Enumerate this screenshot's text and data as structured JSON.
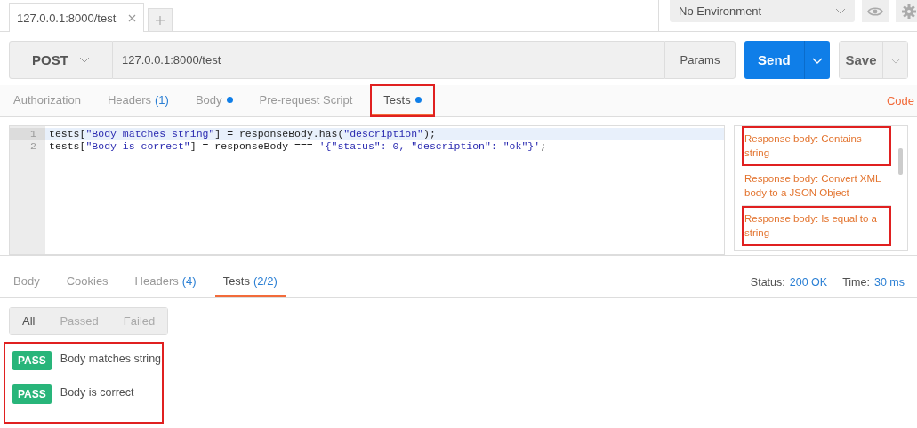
{
  "request_tabs": [
    {
      "label": "127.0.0.1:8000/test",
      "selected": true
    }
  ],
  "environment": {
    "value": "No Environment"
  },
  "request": {
    "method": "POST",
    "url": "127.0.0.1:8000/test",
    "params_button": "Params",
    "send_button": "Send",
    "save_button": "Save"
  },
  "request_sections": [
    {
      "label": "Authorization",
      "selected": false,
      "modified": false,
      "highlighted": false
    },
    {
      "label": "Headers",
      "count": "(1)",
      "selected": false,
      "modified": false,
      "highlighted": false
    },
    {
      "label": "Body",
      "selected": false,
      "modified": true,
      "highlighted": false
    },
    {
      "label": "Pre-request Script",
      "selected": false,
      "modified": false,
      "highlighted": false
    },
    {
      "label": "Tests",
      "selected": true,
      "modified": true,
      "highlighted": true
    }
  ],
  "code_link": "Code",
  "editor": {
    "lines": [
      {
        "number": "1",
        "active": true,
        "tokens": [
          {
            "kind": "plain",
            "text": "tests["
          },
          {
            "kind": "string",
            "text": "\"Body matches string\""
          },
          {
            "kind": "plain",
            "text": "] = responseBody.has("
          },
          {
            "kind": "string",
            "text": "\"description\""
          },
          {
            "kind": "plain",
            "text": ");"
          }
        ]
      },
      {
        "number": "2",
        "active": false,
        "tokens": [
          {
            "kind": "plain",
            "text": "tests["
          },
          {
            "kind": "string",
            "text": "\"Body is correct\""
          },
          {
            "kind": "plain",
            "text": "] = responseBody === "
          },
          {
            "kind": "string",
            "text": "'{\"status\": 0, \"description\": \"ok\"}'"
          },
          {
            "kind": "plain",
            "text": ";"
          }
        ]
      }
    ]
  },
  "snippets": [
    {
      "label": "Response body: Contains string",
      "highlighted": true
    },
    {
      "label": "Response body: Convert XML body to a JSON Object",
      "highlighted": false
    },
    {
      "label": "Response body: Is equal to a string",
      "highlighted": true
    }
  ],
  "response_tabs": [
    {
      "label": "Body",
      "selected": false
    },
    {
      "label": "Cookies",
      "selected": false
    },
    {
      "label": "Headers",
      "count": "(4)",
      "selected": false
    },
    {
      "label": "Tests",
      "count": "(2/2)",
      "selected": true
    }
  ],
  "status": {
    "label": "Status:",
    "value": "200 OK"
  },
  "time": {
    "label": "Time:",
    "value": "30 ms"
  },
  "filters": [
    {
      "label": "All",
      "selected": true
    },
    {
      "label": "Passed",
      "selected": false
    },
    {
      "label": "Failed",
      "selected": false
    }
  ],
  "results": {
    "highlighted": true,
    "items": [
      {
        "status": "PASS",
        "kind": "pass",
        "name": "Body matches string"
      },
      {
        "status": "PASS",
        "kind": "pass",
        "name": "Body is correct"
      }
    ]
  }
}
